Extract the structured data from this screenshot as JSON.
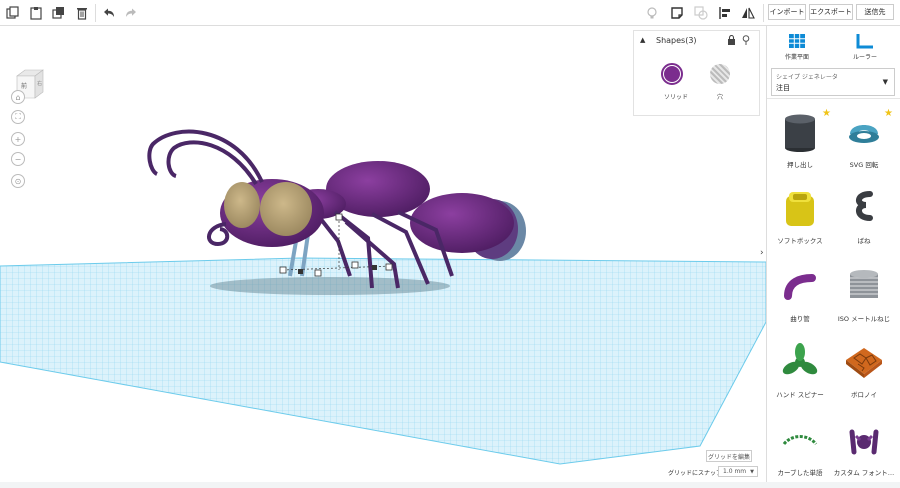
{
  "toolbar": {
    "import_label": "インポート",
    "export_label": "エクスポート",
    "send_label": "送信先"
  },
  "viewcube": {
    "front": "前",
    "right": "右"
  },
  "shapes_panel": {
    "title": "Shapes(3)",
    "solid_label": "ソリッド",
    "hole_label": "穴",
    "solid_color": "#7b2d8e"
  },
  "workplane": {
    "edit_grid_label": "グリッドを編集",
    "snap_label": "グリッドにスナップ",
    "snap_value": "1.0 mm"
  },
  "sidebar": {
    "workplane_tool_label": "作業平面",
    "ruler_tool_label": "ルーラー",
    "generator_label": "シェイプ ジェネレータ",
    "generator_value": "注目",
    "shapes": [
      {
        "label": "押し出し",
        "icon": "extrusion-icon",
        "starred": true
      },
      {
        "label": "SVG 回転",
        "icon": "svg-revolve-icon",
        "starred": true
      },
      {
        "label": "ソフトボックス",
        "icon": "soft-box-icon",
        "starred": false
      },
      {
        "label": "ばね",
        "icon": "spring-icon",
        "starred": false
      },
      {
        "label": "曲り管",
        "icon": "bent-pipe-icon",
        "starred": false
      },
      {
        "label": "ISO メートルねじ",
        "icon": "iso-thread-icon",
        "starred": false
      },
      {
        "label": "ハンド スピナー",
        "icon": "hand-spinner-icon",
        "starred": false
      },
      {
        "label": "ボロノイ",
        "icon": "voronoi-icon",
        "starred": false
      },
      {
        "label": "カーブした単語",
        "icon": "curved-word-icon",
        "starred": false
      },
      {
        "label": "カスタム フォント…",
        "icon": "custom-font-icon",
        "starred": false
      }
    ]
  },
  "colors": {
    "accent": "#0e8bd6",
    "ant_body": "#6b2a7e",
    "grid": "#7fd0ec"
  }
}
